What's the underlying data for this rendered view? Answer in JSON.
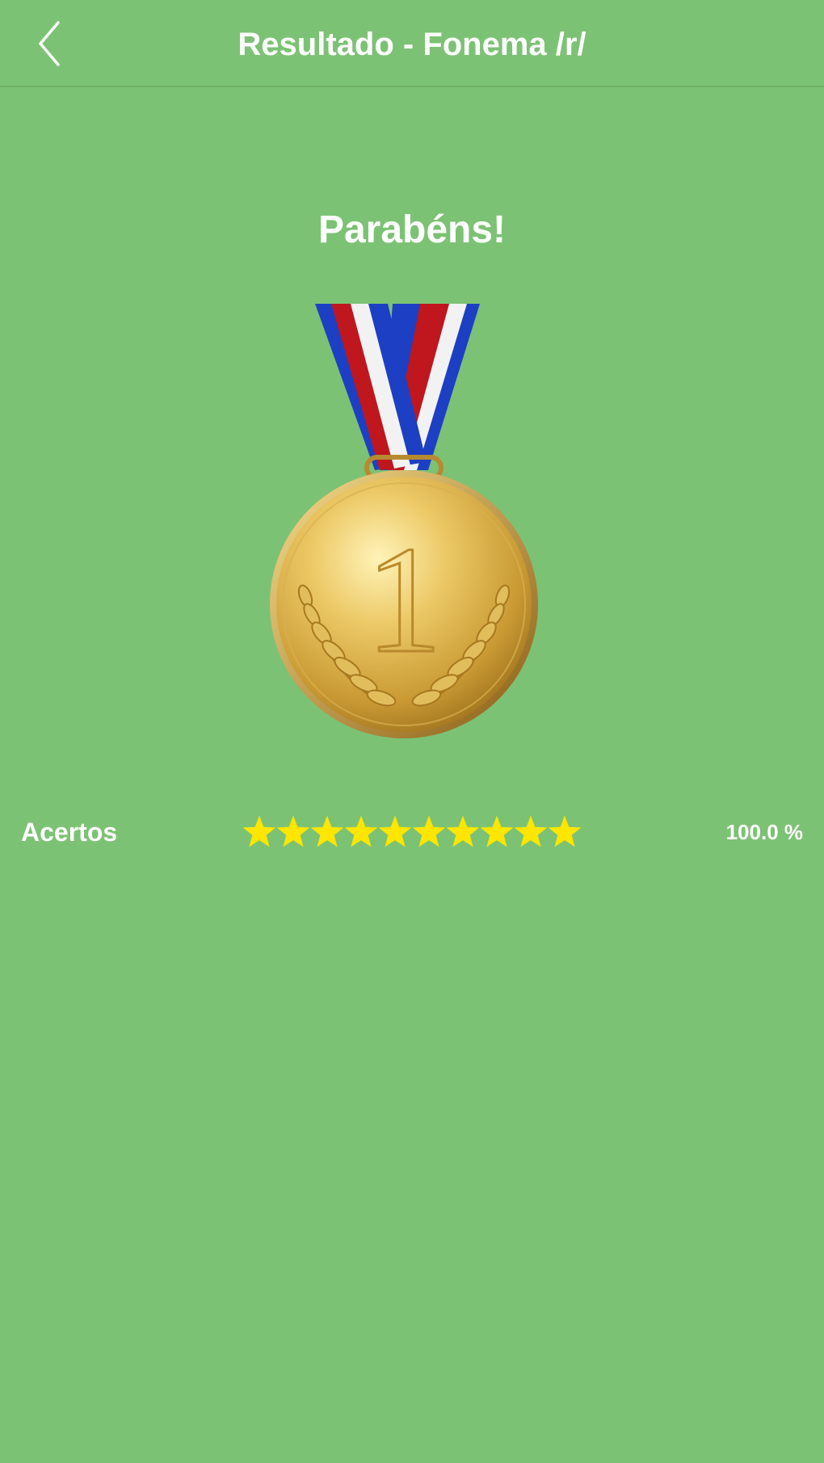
{
  "navbar": {
    "back_icon": "chevron-left-icon",
    "title": "Resultado - Fonema /r/"
  },
  "main": {
    "headline": "Parabéns!",
    "medal": {
      "icon": "gold-medal-icon",
      "number": "1",
      "ribbon_colors": [
        "#1d3fc4",
        "#ffffff",
        "#c0161e"
      ],
      "gold_color": "#e0b64a"
    },
    "score": {
      "label": "Acertos",
      "stars_filled": 10,
      "stars_total": 10,
      "star_color": "#ffe600",
      "percent_text": "100.0 %"
    }
  },
  "colors": {
    "background": "#7cc274",
    "text": "#ffffff"
  }
}
